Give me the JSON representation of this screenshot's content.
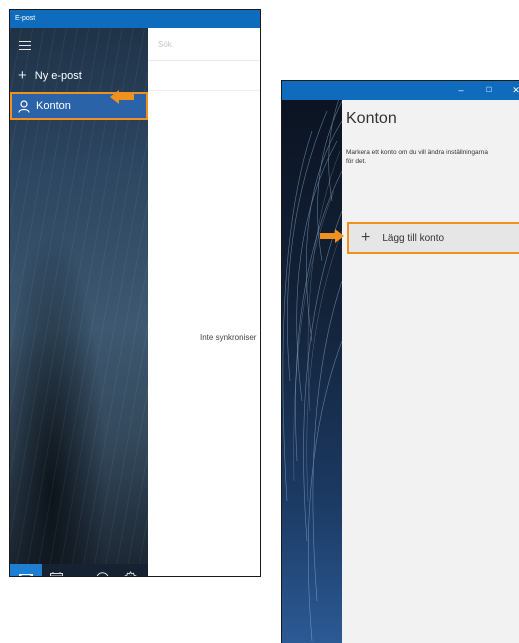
{
  "left_window": {
    "title": "E-post",
    "sidebar": {
      "new_mail_label": "Ny e-post",
      "accounts_label": "Konton"
    },
    "search": {
      "placeholder": "Sök"
    },
    "status_text": "Inte synkroniser"
  },
  "right_window": {
    "panel_title": "Konton",
    "description_line1": "Markera ett konto om du vill ändra inställningarna",
    "description_line2": "för det.",
    "add_account_label": "Lägg till konto",
    "window_controls": {
      "minimize": "–",
      "maximize": "☐",
      "close": "✕"
    }
  },
  "colors": {
    "accent_blue": "#0f6cbd",
    "selected_blue": "#2a63a8",
    "highlight_orange": "#f0901e"
  },
  "icons": [
    "hamburger-icon",
    "plus-icon",
    "person-icon",
    "mail-icon",
    "calendar-icon",
    "smiley-icon",
    "gear-icon",
    "arrow-icon"
  ]
}
